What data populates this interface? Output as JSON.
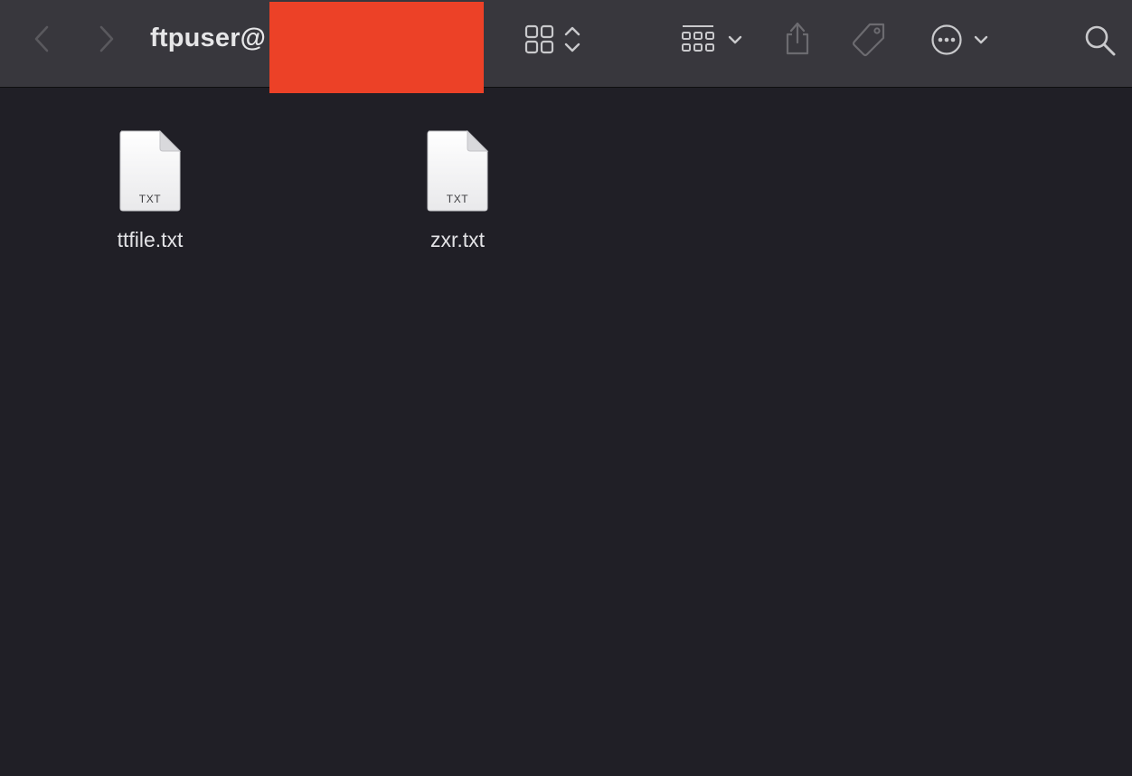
{
  "window": {
    "title": "ftpuser@"
  },
  "toolbar": {
    "back_icon": "chevron-left-icon",
    "forward_icon": "chevron-right-icon",
    "view_icon": "grid-view-icon",
    "group_icon": "group-by-icon",
    "share_icon": "share-icon",
    "tag_icon": "tag-icon",
    "more_icon": "ellipsis-circle-icon",
    "search_icon": "search-icon"
  },
  "files": [
    {
      "name": "ttfile.txt",
      "type": "TXT"
    },
    {
      "name": "zxr.txt",
      "type": "TXT"
    }
  ],
  "colors": {
    "toolbar_bg": "#38373d",
    "content_bg": "#201f26",
    "redaction": "#ec4127"
  }
}
